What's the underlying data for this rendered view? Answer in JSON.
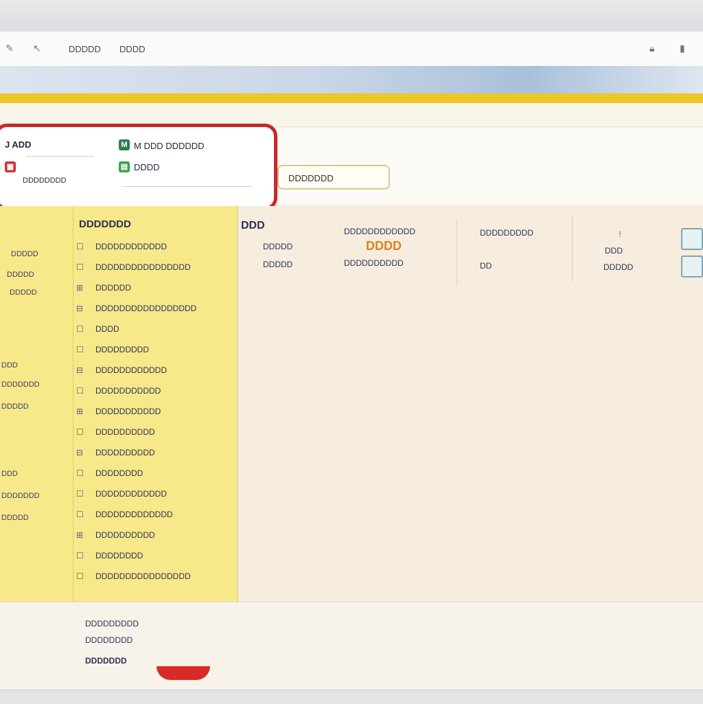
{
  "menubar": {
    "icons": [
      "pencil-icon",
      "cursor-icon"
    ],
    "items": [
      "DDDDD",
      "DDDD"
    ],
    "right_icons": [
      "lock-icon",
      "battery-icon"
    ]
  },
  "panel": {
    "title": "J ADD",
    "title_2": "M DDD DDDDDD",
    "item_2": "DDDD",
    "sub_text": "DDDDDDDD"
  },
  "search": {
    "label": "DDDDDDD"
  },
  "left_nav": {
    "items": [
      "DDDDD",
      "DDDDD",
      "DDDDD",
      "DDD",
      "DDDDDDD",
      "DDDDD",
      "DDD",
      "DDDDDDD",
      "DDDDD"
    ]
  },
  "list": {
    "header": "DDDDDDD",
    "rows": [
      "DDDDDDDDDDDD",
      "DDDDDDDDDDDDDDDD",
      "DDDDDD",
      "DDDDDDDDDDDDDDDDD",
      "DDDD",
      "DDDDDDDDD",
      "DDDDDDDDDDDD",
      "DDDDDDDDDDD",
      "DDDDDDDDDDD",
      "DDDDDDDDDD",
      "DDDDDDDDDD",
      "DDDDDDDD",
      "DDDDDDDDDDDD",
      "DDDDDDDDDDDDD",
      "DDDDDDDDDD",
      "DDDDDDDD",
      "DDDDDDDDDDDDDDDD"
    ]
  },
  "detail": {
    "header": "DDD",
    "col1": [
      "DDDDD",
      "DDDDD"
    ],
    "col2_top": "DDDDDDDDDDDD",
    "col2_value": "DDDD",
    "col2_bottom": "DDDDDDDDDD",
    "col3_top": "DDDDDDDDD",
    "col3_bottom": "DD",
    "col4_mark": "!",
    "col4_a": "DDD",
    "col4_b": "DDDDD"
  },
  "bottom": {
    "lines": [
      "DDDDDDDDD",
      "DDDDDDDD",
      "DDDDDDD"
    ]
  },
  "colors": {
    "accent": "#f0c526",
    "highlight_border": "#c9272b",
    "sidebar": "#f7e88a",
    "detail_bg": "#f6eddf"
  }
}
